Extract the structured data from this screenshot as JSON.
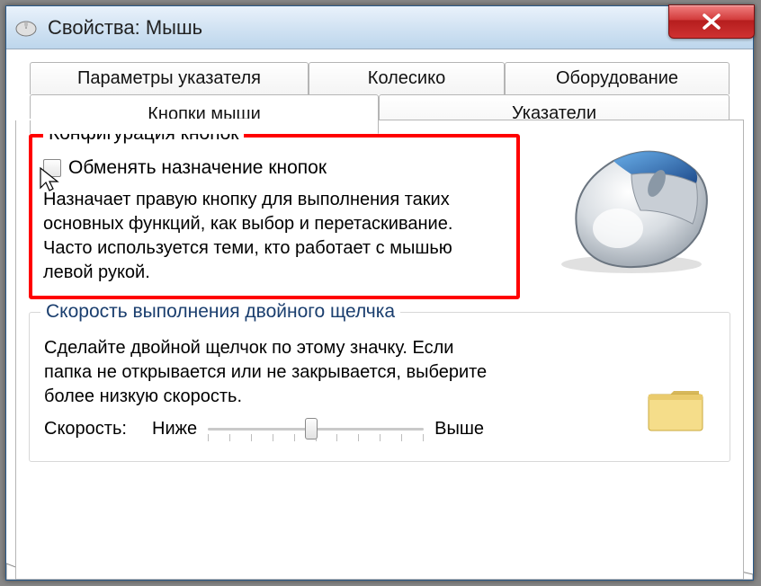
{
  "window": {
    "title": "Свойства: Мышь",
    "close_x": "X"
  },
  "tabs": {
    "pointer_params": "Параметры указателя",
    "wheel": "Колесико",
    "hardware": "Оборудование",
    "buttons": "Кнопки мыши",
    "pointers": "Указатели"
  },
  "buttons_group": {
    "legend": "Конфигурация кнопок",
    "swap_label": "Обменять назначение кнопок",
    "description": "Назначает правую кнопку для выполнения таких основных функций, как выбор и перетаскивание. Часто используется теми, кто работает с мышью левой рукой."
  },
  "speed_group": {
    "legend": "Скорость выполнения двойного щелчка",
    "description": "Сделайте двойной щелчок по этому значку. Если папка не открывается или не закрывается, выберите более низкую скорость.",
    "speed_label": "Скорость:",
    "low": "Ниже",
    "high": "Выше"
  },
  "icons": {
    "app": "mouse-icon",
    "close": "close-icon",
    "cursor": "cursor-icon",
    "mouse_preview": "mouse-preview",
    "folder": "folder-icon"
  }
}
